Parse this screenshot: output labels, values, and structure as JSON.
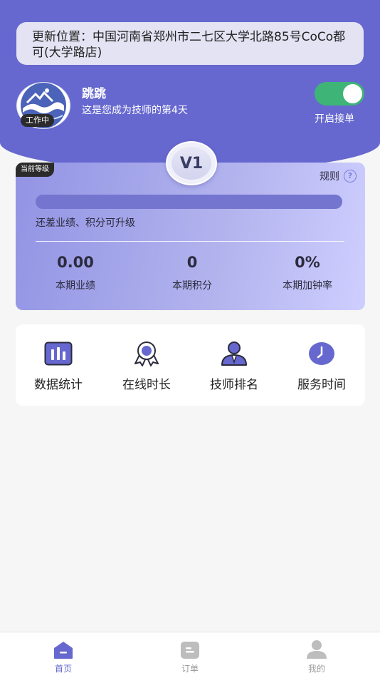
{
  "location": {
    "prefix": "更新位置：",
    "address": "中国河南省郑州市二七区大学北路85号CoCo都可(大学路店)"
  },
  "profile": {
    "name": "跳跳",
    "days_text": "这是您成为技师的第4天",
    "work_status": "工作中",
    "avatar_icon": "wave-logo-icon"
  },
  "order_toggle": {
    "label": "开启接单",
    "on": true
  },
  "level": {
    "tag": "当前等级",
    "badge": "V1",
    "rules_label": "规则",
    "progress": 0,
    "upgrade_text": "还差业绩、积分可升级",
    "stats": [
      {
        "value": "0.00",
        "label": "本期业绩"
      },
      {
        "value": "0",
        "label": "本期积分"
      },
      {
        "value": "0%",
        "label": "本期加钟率"
      }
    ]
  },
  "menu": [
    {
      "label": "数据统计",
      "icon": "bar-chart-icon"
    },
    {
      "label": "在线时长",
      "icon": "award-ribbon-icon"
    },
    {
      "label": "技师排名",
      "icon": "user-rank-icon"
    },
    {
      "label": "服务时间",
      "icon": "clock-icon"
    }
  ],
  "tabbar": [
    {
      "label": "首页",
      "icon": "home-icon",
      "active": true
    },
    {
      "label": "订单",
      "icon": "order-icon",
      "active": false
    },
    {
      "label": "我的",
      "icon": "profile-icon",
      "active": false
    }
  ],
  "colors": {
    "primary": "#6668cf",
    "toggle_on": "#3eb577",
    "inactive": "#bdbdbd"
  }
}
